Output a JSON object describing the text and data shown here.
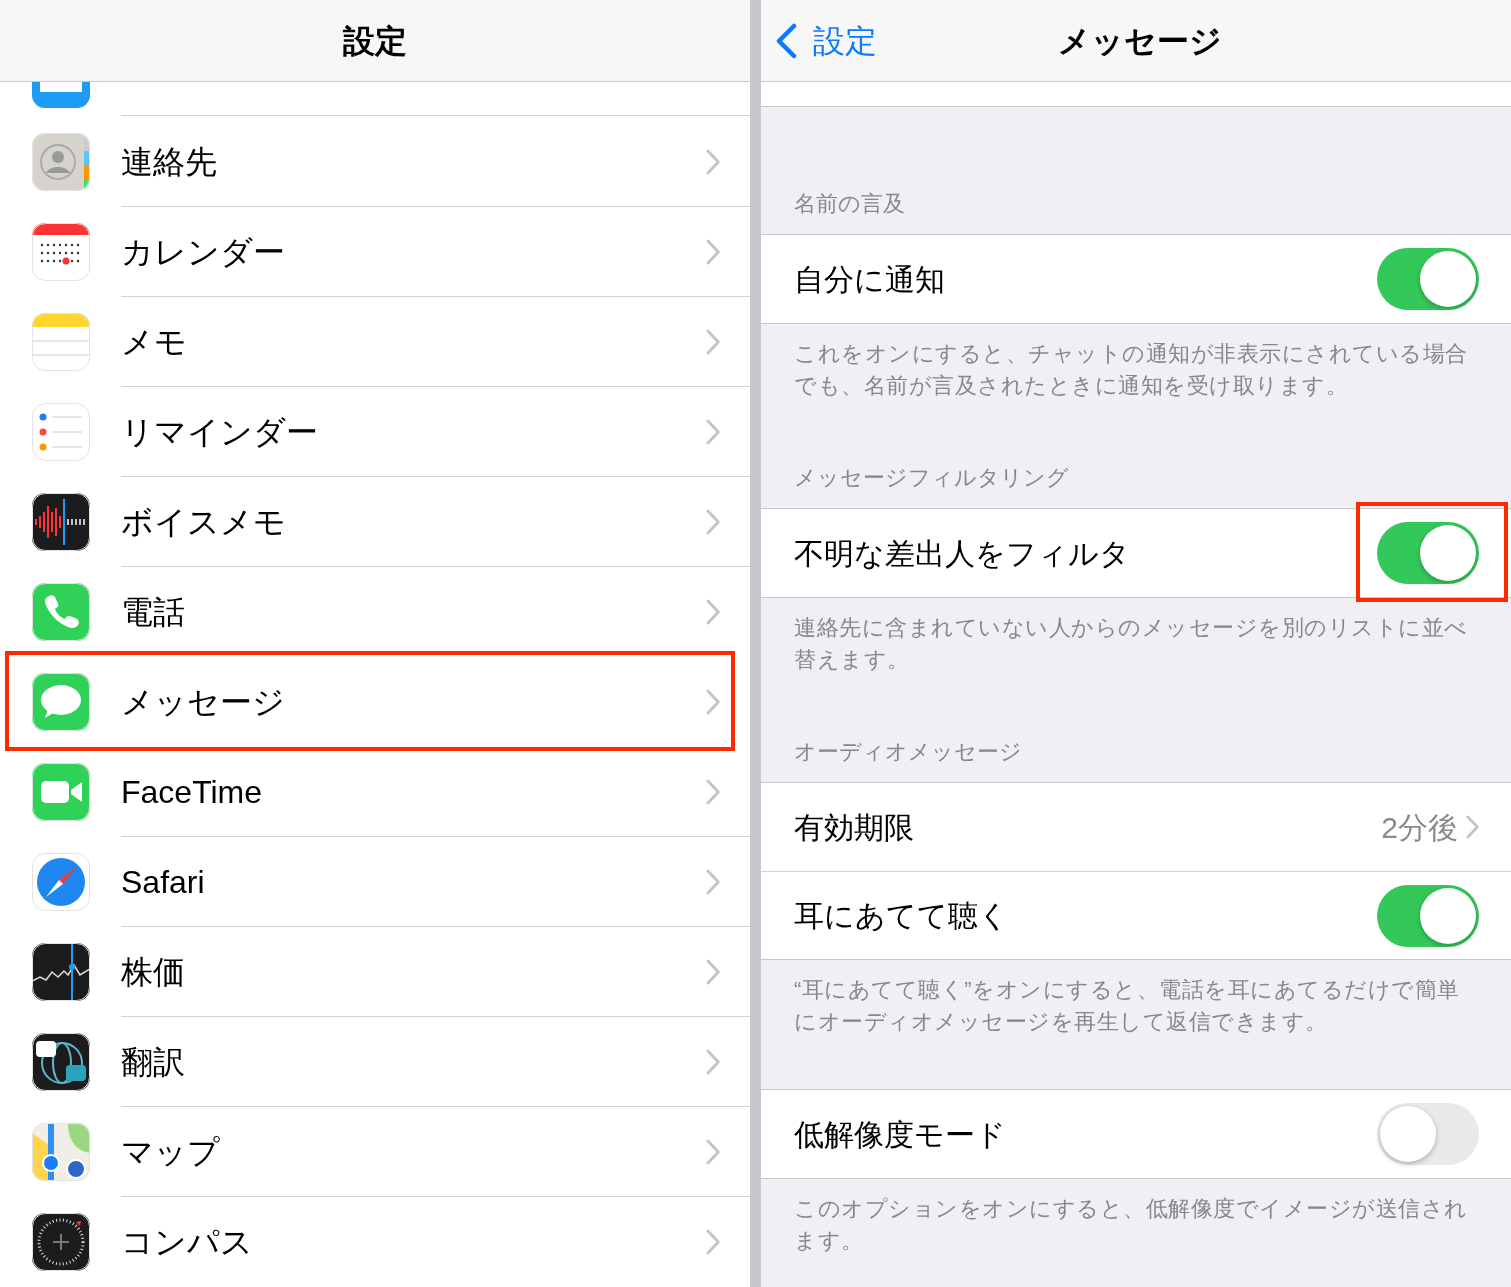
{
  "settings_pane": {
    "title": "設定",
    "items": [
      {
        "label": "連絡先",
        "highlighted": false
      },
      {
        "label": "カレンダー",
        "highlighted": false
      },
      {
        "label": "メモ",
        "highlighted": false
      },
      {
        "label": "リマインダー",
        "highlighted": false
      },
      {
        "label": "ボイスメモ",
        "highlighted": false
      },
      {
        "label": "電話",
        "highlighted": false
      },
      {
        "label": "メッセージ",
        "highlighted": true
      },
      {
        "label": "FaceTime",
        "highlighted": false
      },
      {
        "label": "Safari",
        "highlighted": false
      },
      {
        "label": "株価",
        "highlighted": false
      },
      {
        "label": "翻訳",
        "highlighted": false
      },
      {
        "label": "マップ",
        "highlighted": false
      },
      {
        "label": "コンパス",
        "highlighted": false
      }
    ]
  },
  "messages_pane": {
    "back": "設定",
    "title": "メッセージ",
    "sections": [
      {
        "header": "名前の言及",
        "rows": [
          {
            "kind": "toggle",
            "label": "自分に通知",
            "on": true,
            "highlighted": false
          }
        ],
        "footer": "これをオンにすると、チャットの通知が非表示にされている場合でも、名前が言及されたときに通知を受け取ります。"
      },
      {
        "header": "メッセージフィルタリング",
        "rows": [
          {
            "kind": "toggle",
            "label": "不明な差出人をフィルタ",
            "on": true,
            "highlighted": true
          }
        ],
        "footer": "連絡先に含まれていない人からのメッセージを別のリストに並べ替えます。"
      },
      {
        "header": "オーディオメッセージ",
        "rows": [
          {
            "kind": "value",
            "label": "有効期限",
            "value": "2分後"
          },
          {
            "kind": "toggle",
            "label": "耳にあてて聴く",
            "on": true,
            "highlighted": false
          }
        ],
        "footer": "“耳にあてて聴く”をオンにすると、電話を耳にあてるだけで簡単にオーディオメッセージを再生して返信できます。"
      },
      {
        "rows": [
          {
            "kind": "toggle",
            "label": "低解像度モード",
            "on": false,
            "highlighted": false
          }
        ],
        "footer": "このオプションをオンにすると、低解像度でイメージが送信されます。"
      }
    ]
  }
}
